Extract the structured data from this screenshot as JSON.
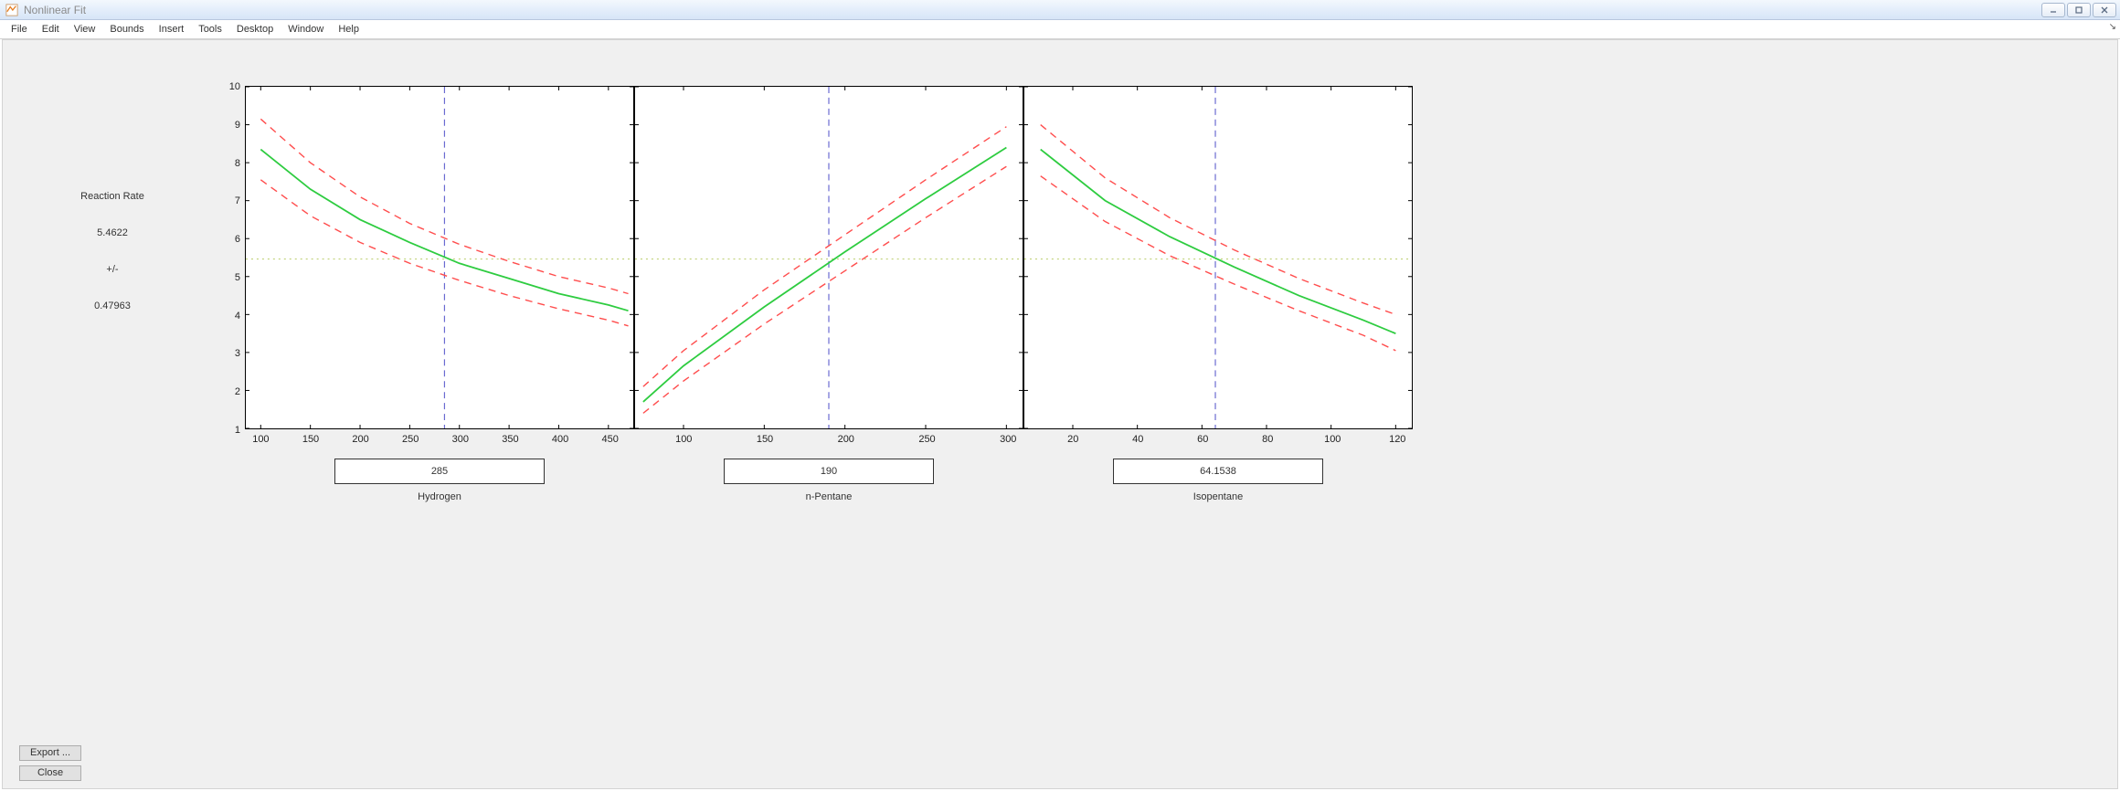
{
  "window": {
    "title": "Nonlinear Fit",
    "menus": [
      "File",
      "Edit",
      "View",
      "Bounds",
      "Insert",
      "Tools",
      "Desktop",
      "Window",
      "Help"
    ]
  },
  "info": {
    "label": "Reaction Rate",
    "value": "5.4622",
    "pm": "+/-",
    "ci": "0.47963"
  },
  "buttons": {
    "export": "Export ...",
    "close": "Close"
  },
  "predictors": [
    {
      "name": "Hydrogen",
      "value": "285"
    },
    {
      "name": "n-Pentane",
      "value": "190"
    },
    {
      "name": "Isopentane",
      "value": "64.1538"
    }
  ],
  "chart_data": [
    {
      "type": "line",
      "predictor": "Hydrogen",
      "xlabel": "Hydrogen",
      "ylabel": "Reaction Rate",
      "ylim": [
        1,
        10
      ],
      "xlim": [
        85,
        475
      ],
      "xticks": [
        100,
        150,
        200,
        250,
        300,
        350,
        400,
        450
      ],
      "yticks": [
        1,
        2,
        3,
        4,
        5,
        6,
        7,
        8,
        9,
        10
      ],
      "slice_x": 285,
      "slice_y": 5.4622,
      "series": [
        {
          "name": "fit",
          "style": "solid",
          "color": "#2ecc40",
          "x": [
            100,
            150,
            200,
            250,
            300,
            350,
            400,
            450,
            470
          ],
          "y": [
            8.35,
            7.3,
            6.5,
            5.9,
            5.35,
            4.95,
            4.55,
            4.25,
            4.1
          ]
        },
        {
          "name": "upper",
          "style": "dashed",
          "color": "#ff4d4d",
          "x": [
            100,
            150,
            200,
            250,
            300,
            350,
            400,
            450,
            470
          ],
          "y": [
            9.15,
            8.0,
            7.1,
            6.4,
            5.85,
            5.4,
            5.0,
            4.7,
            4.55
          ]
        },
        {
          "name": "lower",
          "style": "dashed",
          "color": "#ff4d4d",
          "x": [
            100,
            150,
            200,
            250,
            300,
            350,
            400,
            450,
            470
          ],
          "y": [
            7.55,
            6.6,
            5.9,
            5.35,
            4.9,
            4.5,
            4.15,
            3.85,
            3.7
          ]
        }
      ]
    },
    {
      "type": "line",
      "predictor": "n-Pentane",
      "xlabel": "n-Pentane",
      "ylabel": "",
      "ylim": [
        1,
        10
      ],
      "xlim": [
        70,
        310
      ],
      "xticks": [
        100,
        150,
        200,
        250,
        300
      ],
      "yticks": [
        1,
        2,
        3,
        4,
        5,
        6,
        7,
        8,
        9,
        10
      ],
      "slice_x": 190,
      "slice_y": 5.4622,
      "series": [
        {
          "name": "fit",
          "style": "solid",
          "color": "#2ecc40",
          "x": [
            75,
            100,
            150,
            200,
            250,
            300
          ],
          "y": [
            1.7,
            2.65,
            4.2,
            5.65,
            7.05,
            8.4
          ]
        },
        {
          "name": "upper",
          "style": "dashed",
          "color": "#ff4d4d",
          "x": [
            75,
            100,
            150,
            200,
            250,
            300
          ],
          "y": [
            2.1,
            3.05,
            4.65,
            6.1,
            7.55,
            8.95
          ]
        },
        {
          "name": "lower",
          "style": "dashed",
          "color": "#ff4d4d",
          "x": [
            75,
            100,
            150,
            200,
            250,
            300
          ],
          "y": [
            1.4,
            2.25,
            3.75,
            5.15,
            6.55,
            7.9
          ]
        }
      ]
    },
    {
      "type": "line",
      "predictor": "Isopentane",
      "xlabel": "Isopentane",
      "ylabel": "",
      "ylim": [
        1,
        10
      ],
      "xlim": [
        5,
        125
      ],
      "xticks": [
        20,
        40,
        60,
        80,
        100,
        120
      ],
      "yticks": [
        1,
        2,
        3,
        4,
        5,
        6,
        7,
        8,
        9,
        10
      ],
      "slice_x": 64.1538,
      "slice_y": 5.4622,
      "series": [
        {
          "name": "fit",
          "style": "solid",
          "color": "#2ecc40",
          "x": [
            10,
            30,
            50,
            70,
            90,
            110,
            120
          ],
          "y": [
            8.35,
            7.0,
            6.05,
            5.25,
            4.5,
            3.85,
            3.5
          ]
        },
        {
          "name": "upper",
          "style": "dashed",
          "color": "#ff4d4d",
          "x": [
            10,
            30,
            50,
            70,
            90,
            110,
            120
          ],
          "y": [
            9.0,
            7.6,
            6.55,
            5.7,
            4.95,
            4.3,
            4.0
          ]
        },
        {
          "name": "lower",
          "style": "dashed",
          "color": "#ff4d4d",
          "x": [
            10,
            30,
            50,
            70,
            90,
            110,
            120
          ],
          "y": [
            7.65,
            6.45,
            5.55,
            4.8,
            4.1,
            3.45,
            3.05
          ]
        }
      ]
    }
  ]
}
